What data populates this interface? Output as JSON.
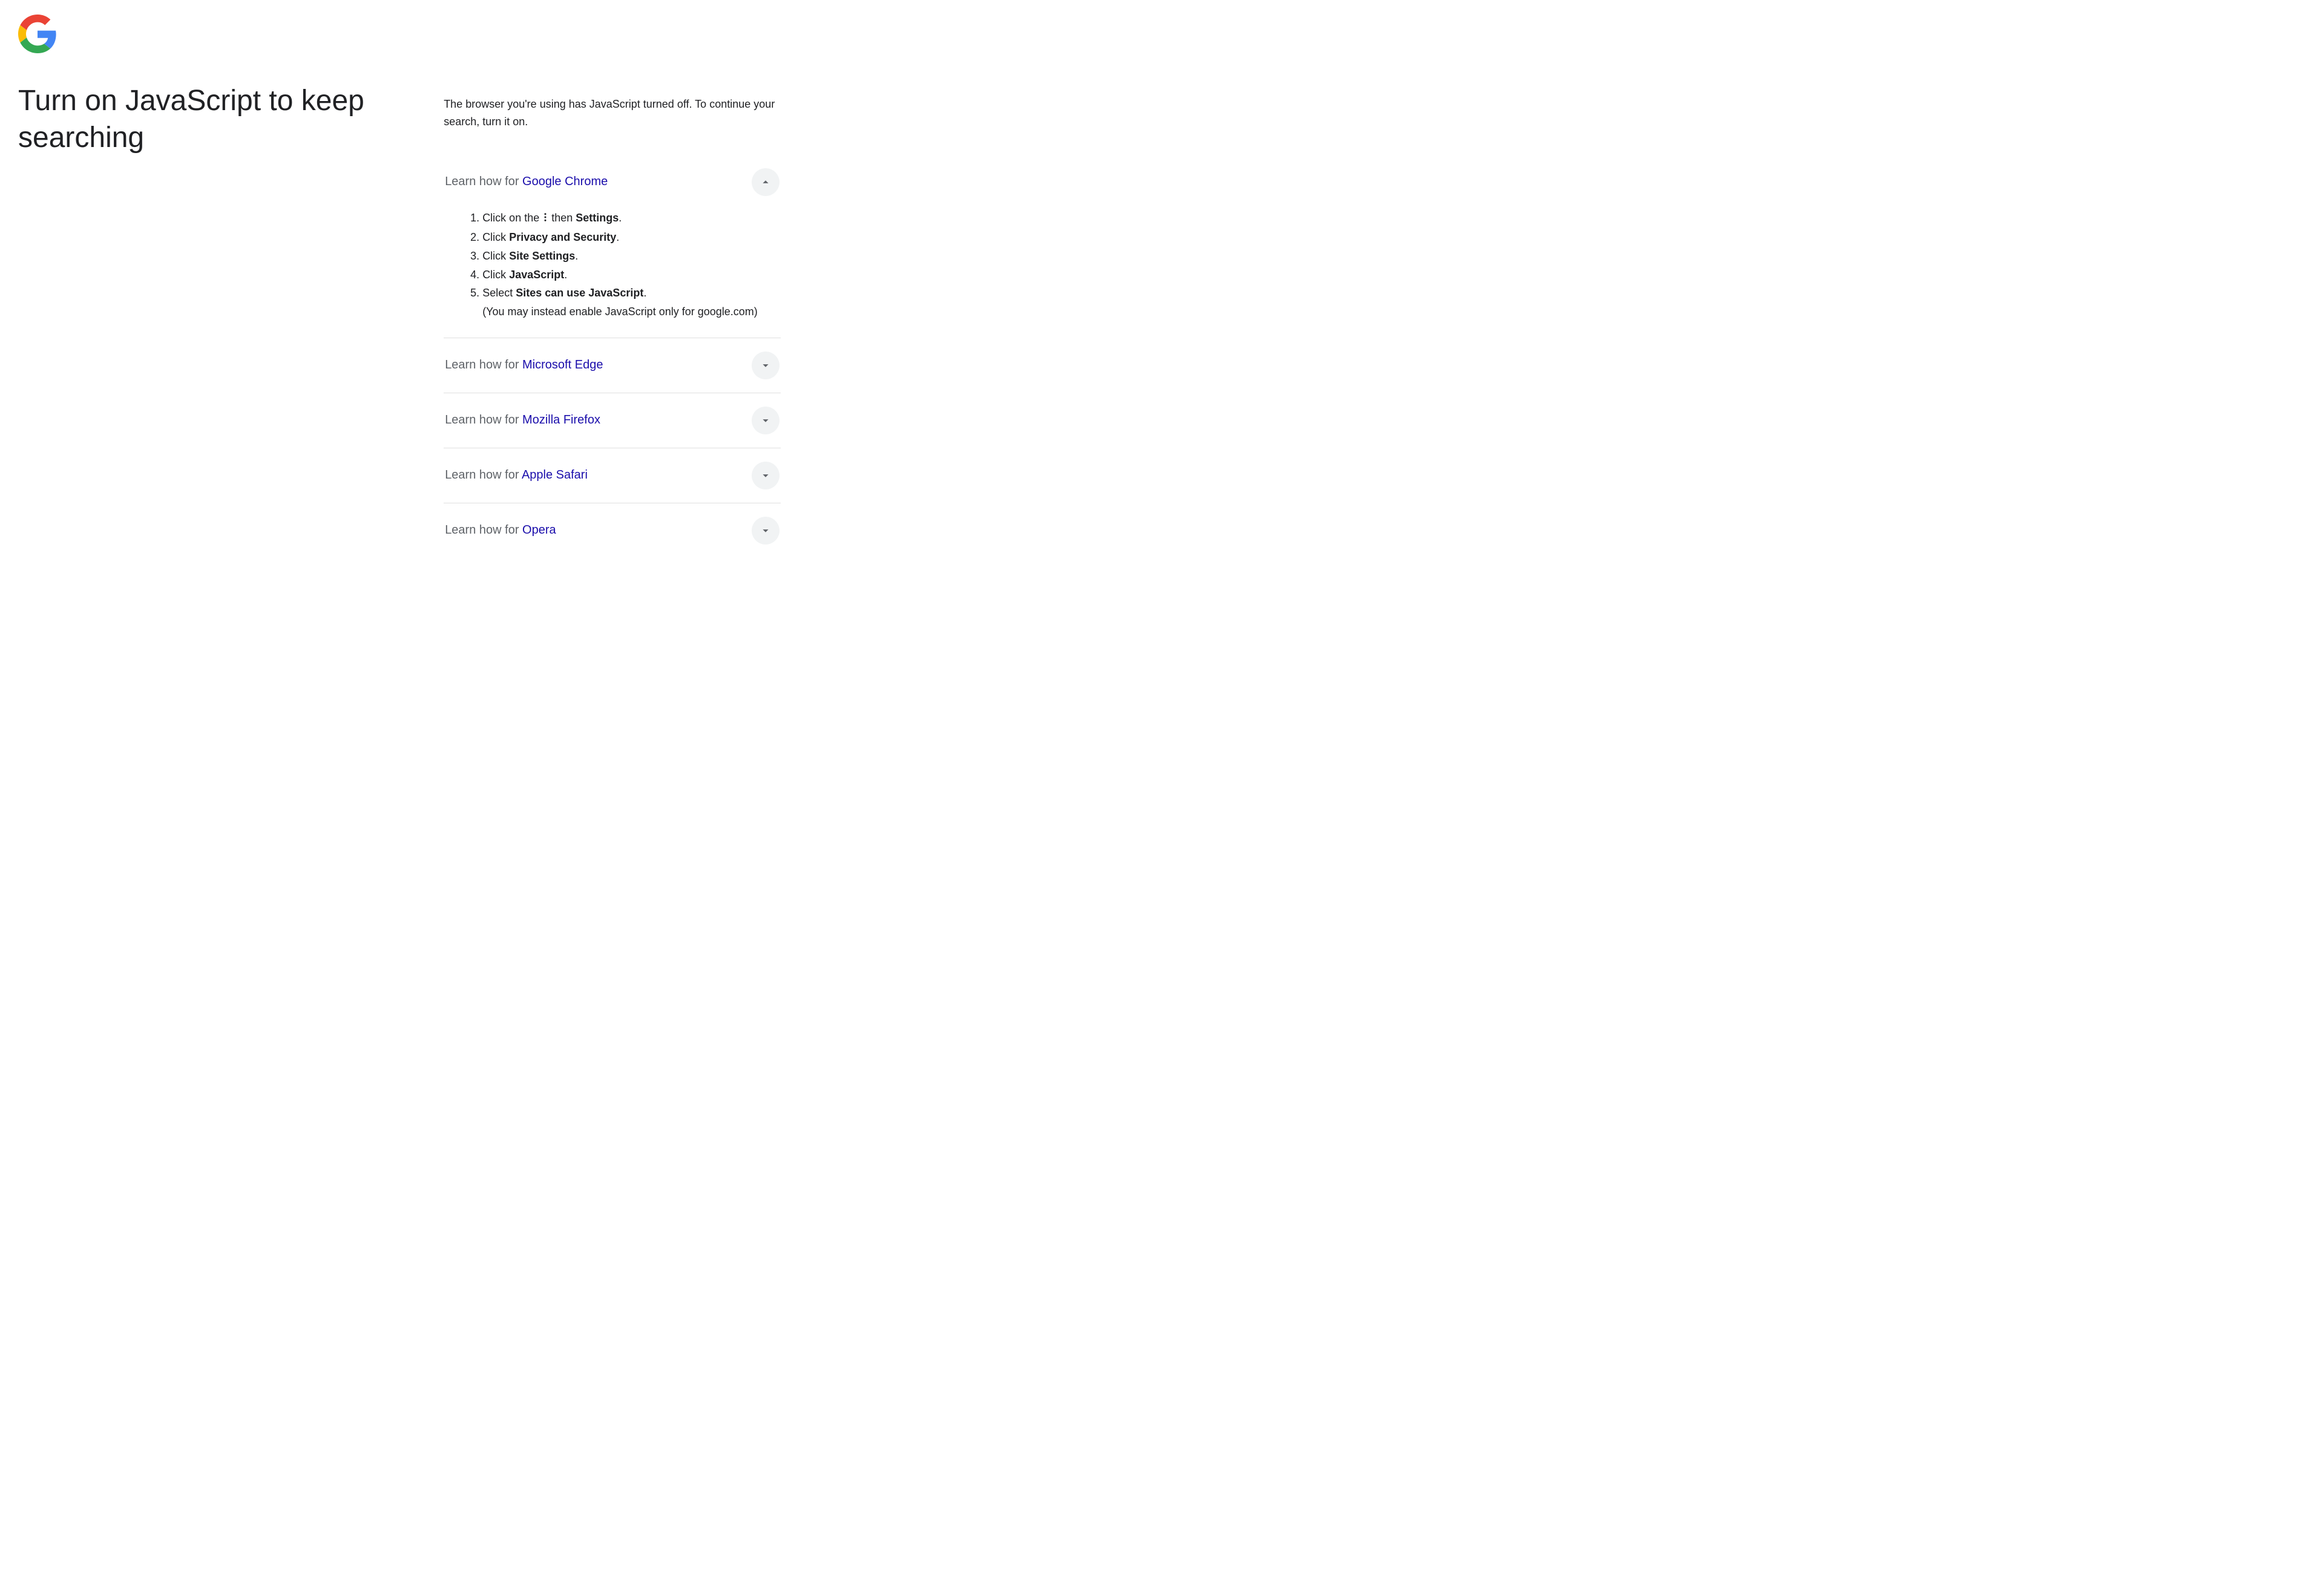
{
  "heading": "Turn on JavaScript to keep searching",
  "intro": "The browser you're using has JavaScript turned off. To continue your search, turn it on.",
  "learn_prefix": "Learn how for ",
  "browsers": {
    "chrome": "Google Chrome",
    "edge": "Microsoft Edge",
    "firefox": "Mozilla Firefox",
    "safari": "Apple Safari",
    "opera": "Opera"
  },
  "chrome_steps": {
    "s1_a": "Click on the ",
    "s1_b": " then ",
    "s1_c": "Settings",
    "s1_d": ".",
    "s2_a": "Click ",
    "s2_b": "Privacy and Security",
    "s2_c": ".",
    "s3_a": "Click ",
    "s3_b": "Site Settings",
    "s3_c": ".",
    "s4_a": "Click ",
    "s4_b": "JavaScript",
    "s4_c": ".",
    "s5_a": "Select ",
    "s5_b": "Sites can use JavaScript",
    "s5_c": ".",
    "note": "(You may instead enable JavaScript only for google.com)"
  }
}
